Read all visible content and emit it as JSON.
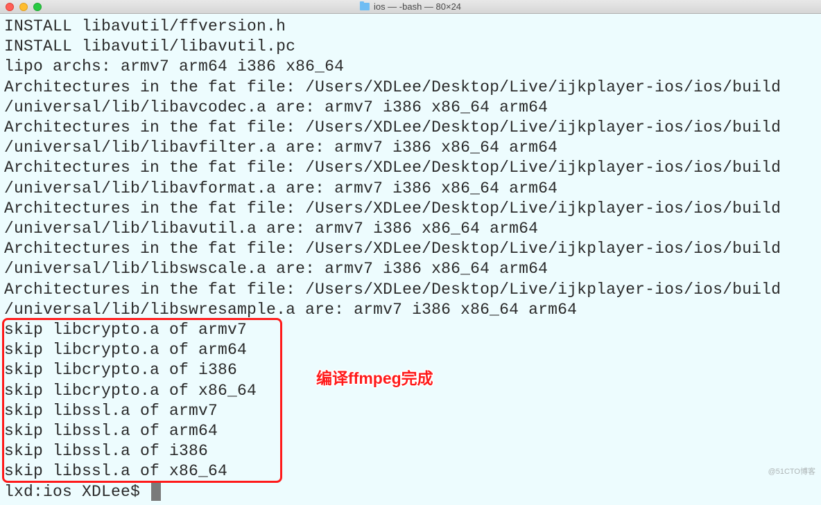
{
  "window": {
    "title": "ios — -bash — 80×24"
  },
  "terminal": {
    "lines": [
      "INSTALL libavutil/ffversion.h",
      "INSTALL libavutil/libavutil.pc",
      "lipo archs: armv7 arm64 i386 x86_64",
      "Architectures in the fat file: /Users/XDLee/Desktop/Live/ijkplayer-ios/ios/build",
      "/universal/lib/libavcodec.a are: armv7 i386 x86_64 arm64 ",
      "Architectures in the fat file: /Users/XDLee/Desktop/Live/ijkplayer-ios/ios/build",
      "/universal/lib/libavfilter.a are: armv7 i386 x86_64 arm64 ",
      "Architectures in the fat file: /Users/XDLee/Desktop/Live/ijkplayer-ios/ios/build",
      "/universal/lib/libavformat.a are: armv7 i386 x86_64 arm64 ",
      "Architectures in the fat file: /Users/XDLee/Desktop/Live/ijkplayer-ios/ios/build",
      "/universal/lib/libavutil.a are: armv7 i386 x86_64 arm64 ",
      "Architectures in the fat file: /Users/XDLee/Desktop/Live/ijkplayer-ios/ios/build",
      "/universal/lib/libswscale.a are: armv7 i386 x86_64 arm64 ",
      "Architectures in the fat file: /Users/XDLee/Desktop/Live/ijkplayer-ios/ios/build",
      "/universal/lib/libswresample.a are: armv7 i386 x86_64 arm64 ",
      "skip libcrypto.a of armv7",
      "skip libcrypto.a of arm64",
      "skip libcrypto.a of i386",
      "skip libcrypto.a of x86_64",
      "skip libssl.a of armv7",
      "skip libssl.a of arm64",
      "skip libssl.a of i386",
      "skip libssl.a of x86_64"
    ],
    "prompt": "lxd:ios XDLee$ "
  },
  "annotation": {
    "text": "编译ffmpeg完成"
  },
  "watermark": "@51CTO博客"
}
